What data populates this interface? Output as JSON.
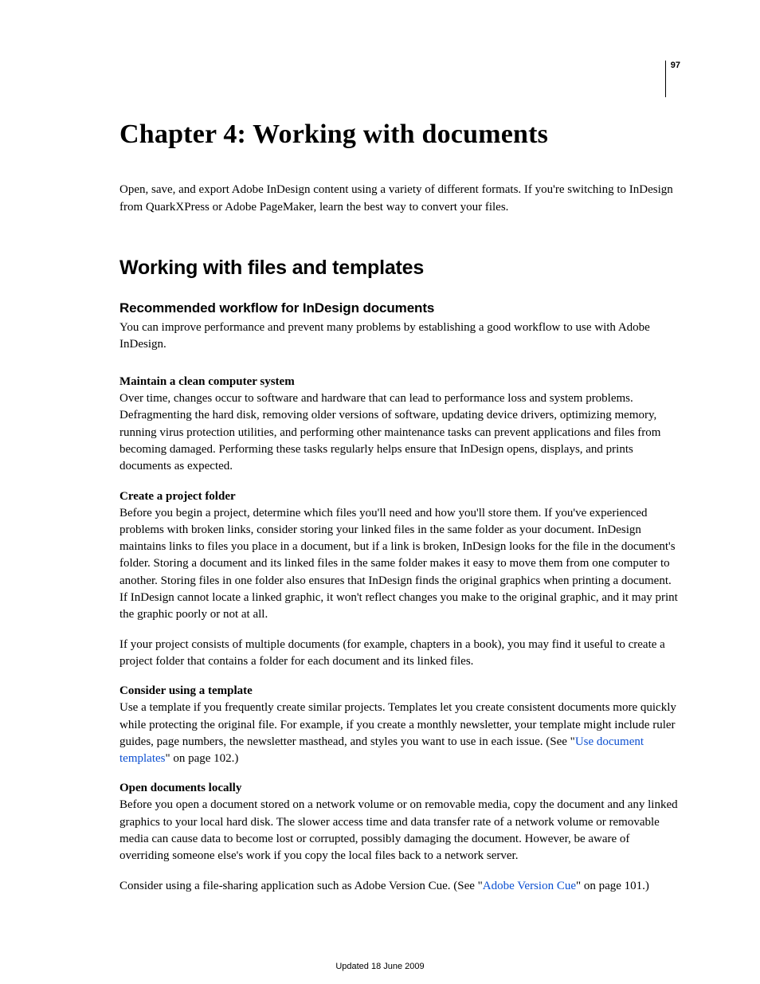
{
  "page_number": "97",
  "chapter_title": "Chapter 4: Working with documents",
  "intro": "Open, save, and export Adobe InDesign content using a variety of different formats. If you're switching to InDesign from QuarkXPress or Adobe PageMaker, learn the best way to convert your files.",
  "section_title": "Working with files and templates",
  "subsection_title": "Recommended workflow for InDesign documents",
  "subsection_intro": "You can improve performance and prevent many problems by establishing a good workflow to use with Adobe InDesign.",
  "topics": [
    {
      "title": "Maintain a clean computer system",
      "paras": [
        "Over time, changes occur to software and hardware that can lead to performance loss and system problems. Defragmenting the hard disk, removing older versions of software, updating device drivers, optimizing memory, running virus protection utilities, and performing other maintenance tasks can prevent applications and files from becoming damaged. Performing these tasks regularly helps ensure that InDesign opens, displays, and prints documents as expected."
      ]
    },
    {
      "title": "Create a project folder",
      "paras": [
        "Before you begin a project, determine which files you'll need and how you'll store them. If you've experienced problems with broken links, consider storing your linked files in the same folder as your document. InDesign maintains links to files you place in a document, but if a link is broken, InDesign looks for the file in the document's folder. Storing a document and its linked files in the same folder makes it easy to move them from one computer to another. Storing files in one folder also ensures that InDesign finds the original graphics when printing a document. If InDesign cannot locate a linked graphic, it won't reflect changes you make to the original graphic, and it may print the graphic poorly or not at all.",
        "If your project consists of multiple documents (for example, chapters in a book), you may find it useful to create a project folder that contains a folder for each document and its linked files."
      ]
    },
    {
      "title": "Consider using a template",
      "pre": "Use a template if you frequently create similar projects. Templates let you create consistent documents more quickly while protecting the original file. For example, if you create a monthly newsletter, your template might include ruler guides, page numbers, the newsletter masthead, and styles you want to use in each issue. (See \"",
      "link": "Use document templates",
      "post": "\" on page 102.)"
    },
    {
      "title": "Open documents locally",
      "paras": [
        "Before you open a document stored on a network volume or on removable media, copy the document and any linked graphics to your local hard disk. The slower access time and data transfer rate of a network volume or removable media can cause data to become lost or corrupted, possibly damaging the document. However, be aware of overriding someone else's work if you copy the local files back to a network server."
      ],
      "post_pre": "Consider using a file-sharing application such as Adobe Version Cue. (See \"",
      "post_link": "Adobe Version Cue",
      "post_post": "\" on page 101.)"
    }
  ],
  "footer": "Updated 18 June 2009"
}
